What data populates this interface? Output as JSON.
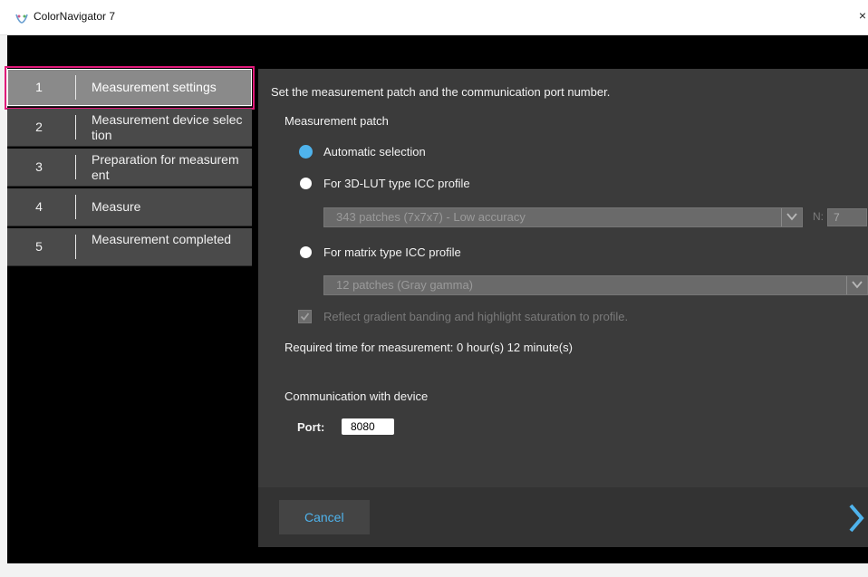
{
  "window": {
    "title": "ColorNavigator 7",
    "close_glyph": "×",
    "app_icon": "colornavigator-icon"
  },
  "sidebar": {
    "items": [
      {
        "number": "1",
        "label": "Measurement settings",
        "active": true
      },
      {
        "number": "2",
        "label": "Measurement device selection",
        "active": false
      },
      {
        "number": "3",
        "label": "Preparation for measurement",
        "active": false
      },
      {
        "number": "4",
        "label": "Measure",
        "active": false
      },
      {
        "number": "5",
        "label": "Measurement completed",
        "active": false
      }
    ]
  },
  "main": {
    "description": "Set the measurement patch and the communication port number.",
    "patch_heading": "Measurement patch",
    "options": {
      "auto": {
        "label": "Automatic selection",
        "selected": true
      },
      "lut3d": {
        "label": "For 3D-LUT type ICC profile",
        "selected": false
      },
      "matrix": {
        "label": "For matrix type ICC profile",
        "selected": false
      }
    },
    "lut_select_value": "343 patches (7x7x7) - Low accuracy",
    "n_label": "N:",
    "n_value": "7",
    "matrix_select_value": "12 patches (Gray gamma)",
    "reflect_checkbox_label": "Reflect gradient banding and highlight saturation to profile.",
    "reflect_checked": true,
    "required_time": "Required time for measurement: 0 hour(s) 12 minute(s)",
    "comm_heading": "Communication with device",
    "port_label": "Port:",
    "port_value": "8080"
  },
  "footer": {
    "cancel_label": "Cancel",
    "next_icon": "chevron-right-icon"
  },
  "colors": {
    "accent": "#4fb3ec",
    "highlight_border": "#e0197a",
    "sidebar_bg": "#4a4a4a",
    "sidebar_active_bg": "#8a8a8a",
    "panel_bg": "#3b3b3b"
  }
}
